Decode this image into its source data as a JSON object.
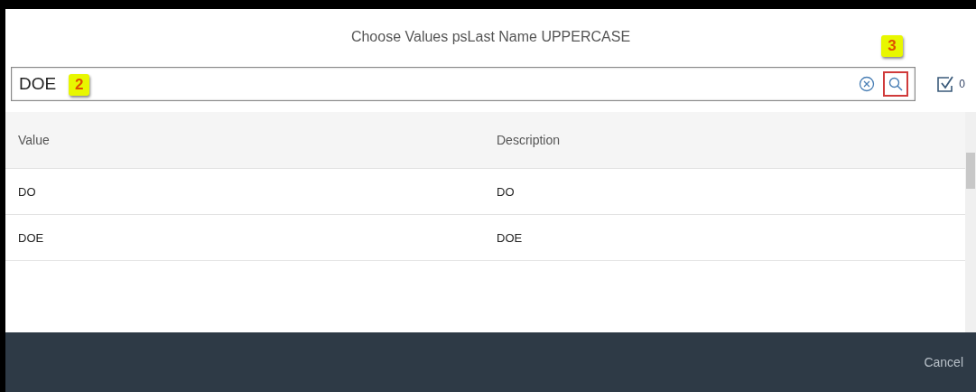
{
  "dialog": {
    "title": "Choose Values psLast Name UPPERCASE"
  },
  "search": {
    "value": "DOE",
    "callout": "2"
  },
  "search_button": {
    "callout": "3"
  },
  "selected_count": "0",
  "table": {
    "columns": [
      "Value",
      "Description"
    ],
    "rows": [
      [
        "DO",
        "DO"
      ],
      [
        "DOE",
        "DOE"
      ]
    ]
  },
  "footer": {
    "cancel": "Cancel"
  }
}
